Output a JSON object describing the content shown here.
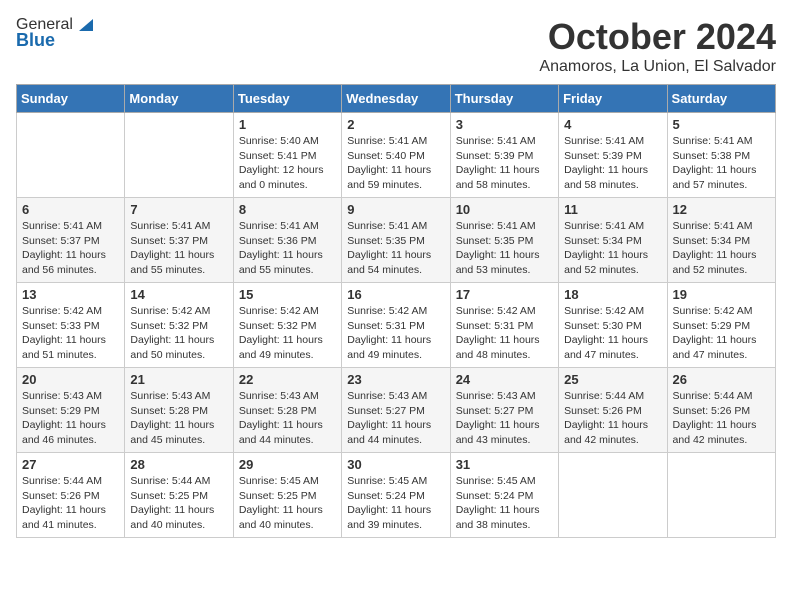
{
  "logo": {
    "general": "General",
    "blue": "Blue"
  },
  "header": {
    "month": "October 2024",
    "location": "Anamoros, La Union, El Salvador"
  },
  "days_of_week": [
    "Sunday",
    "Monday",
    "Tuesday",
    "Wednesday",
    "Thursday",
    "Friday",
    "Saturday"
  ],
  "weeks": [
    [
      {
        "day": "",
        "info": ""
      },
      {
        "day": "",
        "info": ""
      },
      {
        "day": "1",
        "info": "Sunrise: 5:40 AM\nSunset: 5:41 PM\nDaylight: 12 hours and 0 minutes."
      },
      {
        "day": "2",
        "info": "Sunrise: 5:41 AM\nSunset: 5:40 PM\nDaylight: 11 hours and 59 minutes."
      },
      {
        "day": "3",
        "info": "Sunrise: 5:41 AM\nSunset: 5:39 PM\nDaylight: 11 hours and 58 minutes."
      },
      {
        "day": "4",
        "info": "Sunrise: 5:41 AM\nSunset: 5:39 PM\nDaylight: 11 hours and 58 minutes."
      },
      {
        "day": "5",
        "info": "Sunrise: 5:41 AM\nSunset: 5:38 PM\nDaylight: 11 hours and 57 minutes."
      }
    ],
    [
      {
        "day": "6",
        "info": "Sunrise: 5:41 AM\nSunset: 5:37 PM\nDaylight: 11 hours and 56 minutes."
      },
      {
        "day": "7",
        "info": "Sunrise: 5:41 AM\nSunset: 5:37 PM\nDaylight: 11 hours and 55 minutes."
      },
      {
        "day": "8",
        "info": "Sunrise: 5:41 AM\nSunset: 5:36 PM\nDaylight: 11 hours and 55 minutes."
      },
      {
        "day": "9",
        "info": "Sunrise: 5:41 AM\nSunset: 5:35 PM\nDaylight: 11 hours and 54 minutes."
      },
      {
        "day": "10",
        "info": "Sunrise: 5:41 AM\nSunset: 5:35 PM\nDaylight: 11 hours and 53 minutes."
      },
      {
        "day": "11",
        "info": "Sunrise: 5:41 AM\nSunset: 5:34 PM\nDaylight: 11 hours and 52 minutes."
      },
      {
        "day": "12",
        "info": "Sunrise: 5:41 AM\nSunset: 5:34 PM\nDaylight: 11 hours and 52 minutes."
      }
    ],
    [
      {
        "day": "13",
        "info": "Sunrise: 5:42 AM\nSunset: 5:33 PM\nDaylight: 11 hours and 51 minutes."
      },
      {
        "day": "14",
        "info": "Sunrise: 5:42 AM\nSunset: 5:32 PM\nDaylight: 11 hours and 50 minutes."
      },
      {
        "day": "15",
        "info": "Sunrise: 5:42 AM\nSunset: 5:32 PM\nDaylight: 11 hours and 49 minutes."
      },
      {
        "day": "16",
        "info": "Sunrise: 5:42 AM\nSunset: 5:31 PM\nDaylight: 11 hours and 49 minutes."
      },
      {
        "day": "17",
        "info": "Sunrise: 5:42 AM\nSunset: 5:31 PM\nDaylight: 11 hours and 48 minutes."
      },
      {
        "day": "18",
        "info": "Sunrise: 5:42 AM\nSunset: 5:30 PM\nDaylight: 11 hours and 47 minutes."
      },
      {
        "day": "19",
        "info": "Sunrise: 5:42 AM\nSunset: 5:29 PM\nDaylight: 11 hours and 47 minutes."
      }
    ],
    [
      {
        "day": "20",
        "info": "Sunrise: 5:43 AM\nSunset: 5:29 PM\nDaylight: 11 hours and 46 minutes."
      },
      {
        "day": "21",
        "info": "Sunrise: 5:43 AM\nSunset: 5:28 PM\nDaylight: 11 hours and 45 minutes."
      },
      {
        "day": "22",
        "info": "Sunrise: 5:43 AM\nSunset: 5:28 PM\nDaylight: 11 hours and 44 minutes."
      },
      {
        "day": "23",
        "info": "Sunrise: 5:43 AM\nSunset: 5:27 PM\nDaylight: 11 hours and 44 minutes."
      },
      {
        "day": "24",
        "info": "Sunrise: 5:43 AM\nSunset: 5:27 PM\nDaylight: 11 hours and 43 minutes."
      },
      {
        "day": "25",
        "info": "Sunrise: 5:44 AM\nSunset: 5:26 PM\nDaylight: 11 hours and 42 minutes."
      },
      {
        "day": "26",
        "info": "Sunrise: 5:44 AM\nSunset: 5:26 PM\nDaylight: 11 hours and 42 minutes."
      }
    ],
    [
      {
        "day": "27",
        "info": "Sunrise: 5:44 AM\nSunset: 5:26 PM\nDaylight: 11 hours and 41 minutes."
      },
      {
        "day": "28",
        "info": "Sunrise: 5:44 AM\nSunset: 5:25 PM\nDaylight: 11 hours and 40 minutes."
      },
      {
        "day": "29",
        "info": "Sunrise: 5:45 AM\nSunset: 5:25 PM\nDaylight: 11 hours and 40 minutes."
      },
      {
        "day": "30",
        "info": "Sunrise: 5:45 AM\nSunset: 5:24 PM\nDaylight: 11 hours and 39 minutes."
      },
      {
        "day": "31",
        "info": "Sunrise: 5:45 AM\nSunset: 5:24 PM\nDaylight: 11 hours and 38 minutes."
      },
      {
        "day": "",
        "info": ""
      },
      {
        "day": "",
        "info": ""
      }
    ]
  ]
}
